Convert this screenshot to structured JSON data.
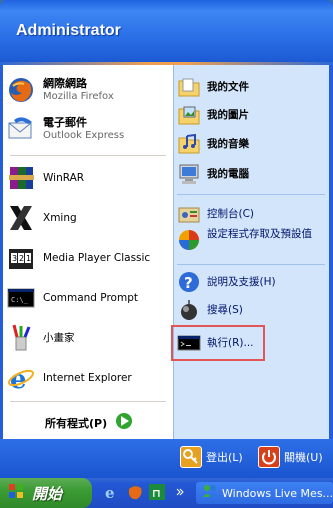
{
  "header": {
    "username": "Administrator"
  },
  "pinned": [
    {
      "title": "網際網路",
      "subtitle": "Mozilla Firefox",
      "icon": "firefox-icon"
    },
    {
      "title": "電子郵件",
      "subtitle": "Outlook Express",
      "icon": "outlook-express-icon"
    }
  ],
  "recent": [
    {
      "label": "WinRAR",
      "icon": "winrar-icon"
    },
    {
      "label": "Xming",
      "icon": "xming-icon"
    },
    {
      "label": "Media Player Classic",
      "icon": "media-player-classic-icon"
    },
    {
      "label": "Command Prompt",
      "icon": "command-prompt-icon"
    },
    {
      "label": "小畫家",
      "icon": "paint-icon"
    },
    {
      "label": "Internet Explorer",
      "icon": "internet-explorer-icon"
    }
  ],
  "all_programs": {
    "label": "所有程式(P)"
  },
  "places": [
    {
      "label": "我的文件",
      "icon": "my-documents-icon"
    },
    {
      "label": "我的圖片",
      "icon": "my-pictures-icon"
    },
    {
      "label": "我的音樂",
      "icon": "my-music-icon"
    },
    {
      "label": "我的電腦",
      "icon": "my-computer-icon"
    }
  ],
  "system": [
    {
      "label": "控制台(C)",
      "icon": "control-panel-icon"
    },
    {
      "label": "設定程式存取及預設值",
      "icon": "program-access-icon"
    }
  ],
  "tools": [
    {
      "label": "說明及支援(H)",
      "icon": "help-icon"
    },
    {
      "label": "搜尋(S)",
      "icon": "search-icon"
    },
    {
      "label": "執行(R)...",
      "icon": "run-icon"
    }
  ],
  "footer": {
    "logoff": "登出(L)",
    "shutdown": "關機(U)"
  },
  "taskbar": {
    "start_label": "開始",
    "active_window": "Windows Live Mes..."
  }
}
